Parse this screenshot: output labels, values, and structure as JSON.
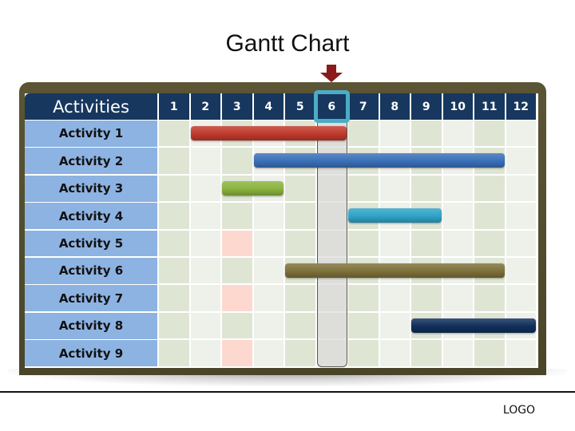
{
  "chart_data": {
    "type": "gantt",
    "title": "Gantt Chart",
    "header_label": "Activities",
    "months": [
      "1",
      "2",
      "3",
      "4",
      "5",
      "6",
      "7",
      "8",
      "9",
      "10",
      "11",
      "12"
    ],
    "current_month": 6,
    "activities": [
      {
        "name": "Activity 1",
        "start": 2,
        "end": 6,
        "color": "#c0392b"
      },
      {
        "name": "Activity 2",
        "start": 4,
        "end": 11,
        "color": "#3a6fb8"
      },
      {
        "name": "Activity 3",
        "start": 3,
        "end": 4,
        "color": "#8ab33d"
      },
      {
        "name": "Activity 4",
        "start": 7,
        "end": 9,
        "color": "#2ea3c7"
      },
      {
        "name": "Activity 5",
        "start": null,
        "end": null,
        "color": null
      },
      {
        "name": "Activity 6",
        "start": 5,
        "end": 11,
        "color": "#7d703a"
      },
      {
        "name": "Activity 7",
        "start": null,
        "end": null,
        "color": null
      },
      {
        "name": "Activity 8",
        "start": 9,
        "end": 12,
        "color": "#0f2f5a"
      },
      {
        "name": "Activity 9",
        "start": null,
        "end": null,
        "color": null
      }
    ],
    "highlighted_cells": [
      {
        "activity": 5,
        "month": 3
      },
      {
        "activity": 7,
        "month": 3
      },
      {
        "activity": 9,
        "month": 3
      }
    ]
  },
  "colors": {
    "header_bg": "#17375e",
    "label_bg": "#8db3e2",
    "frame": "#4f4a2e",
    "col_odd": "#dfe5d3",
    "col_even": "#eef0ea",
    "highlight_cell": "#fcd8cf",
    "current_marker": "#4bacc6",
    "arrow": "#8b1a1a"
  },
  "footer": {
    "logo": "LOGO"
  }
}
